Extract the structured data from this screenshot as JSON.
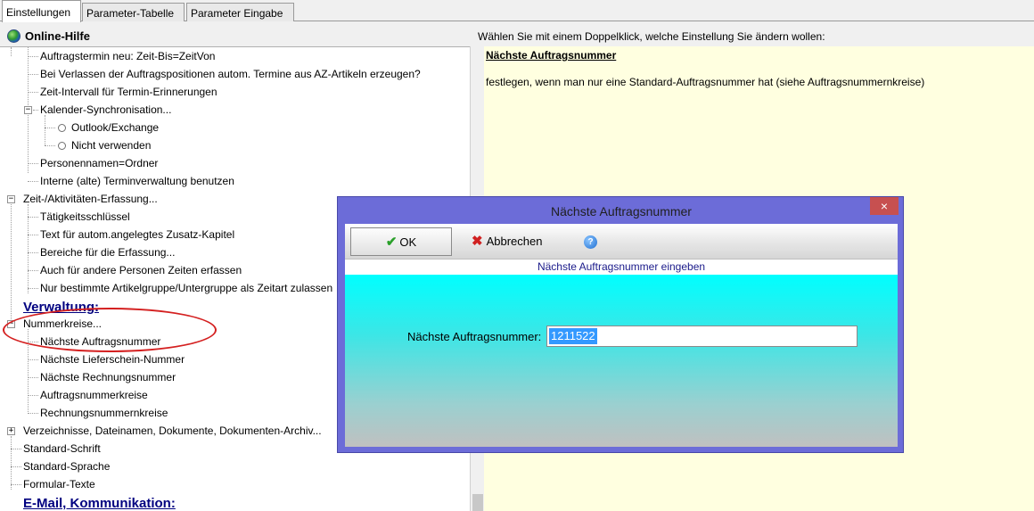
{
  "tabs": [
    "Einstellungen",
    "Parameter-Tabelle",
    "Parameter Eingabe"
  ],
  "help_bar": {
    "title": "Online-Hilfe",
    "instruction": "Wählen Sie mit einem Doppelklick, welche Einstellung Sie ändern wollen:"
  },
  "tree": {
    "items": [
      "Auftragstermin neu: Zeit-Bis=ZeitVon",
      "Bei Verlassen der Auftragspositionen autom. Termine aus AZ-Artikeln erzeugen?",
      "Zeit-Intervall für Termin-Erinnerungen",
      "Kalender-Synchronisation...",
      "Outlook/Exchange",
      "Nicht verwenden",
      "Personennamen=Ordner",
      "Interne (alte) Terminverwaltung benutzen",
      "Zeit-/Aktivitäten-Erfassung...",
      "Tätigkeitsschlüssel",
      "Text für autom.angelegtes Zusatz-Kapitel",
      "Bereiche für die Erfassung...",
      "Auch für andere Personen Zeiten erfassen",
      "Nur bestimmte Artikelgruppe/Untergruppe als Zeitart zulassen",
      "Verwaltung:",
      "Nummerkreise...",
      "Nächste Auftragsnummer",
      "Nächste Lieferschein-Nummer",
      "Nächste Rechnungsnummer",
      "Auftragsnummerkreise",
      "Rechnungsnummernkreise",
      "Verzeichnisse, Dateinamen, Dokumente, Dokumenten-Archiv...",
      "Standard-Schrift",
      "Standard-Sprache",
      "Formular-Texte",
      "E-Mail, Kommunikation:"
    ]
  },
  "right_panel": {
    "title": "Nächste Auftragsnummer",
    "description": "festlegen, wenn man nur eine Standard-Auftragsnummer hat (siehe Auftragsnummernkreise)"
  },
  "dialog": {
    "title": "Nächste Auftragsnummer",
    "close_glyph": "×",
    "ok_label": "OK",
    "cancel_label": "Abbrechen",
    "help_glyph": "?",
    "subheader": "Nächste Auftragsnummer eingeben",
    "field_label": "Nächste Auftragsnummer:",
    "field_value": "1211522"
  },
  "colors": {
    "dialog_frame": "#6c6cd8",
    "close_button": "#c75050",
    "content_gradient_top": "#00ffff",
    "right_panel_bg": "#ffffe0",
    "section_heading": "#000080",
    "annotation": "#d42020"
  },
  "icons": [
    "globe-icon",
    "check-icon",
    "cancel-x-icon",
    "help-icon",
    "close-icon",
    "expand-minus-icon",
    "expand-plus-icon",
    "radio-icon"
  ]
}
